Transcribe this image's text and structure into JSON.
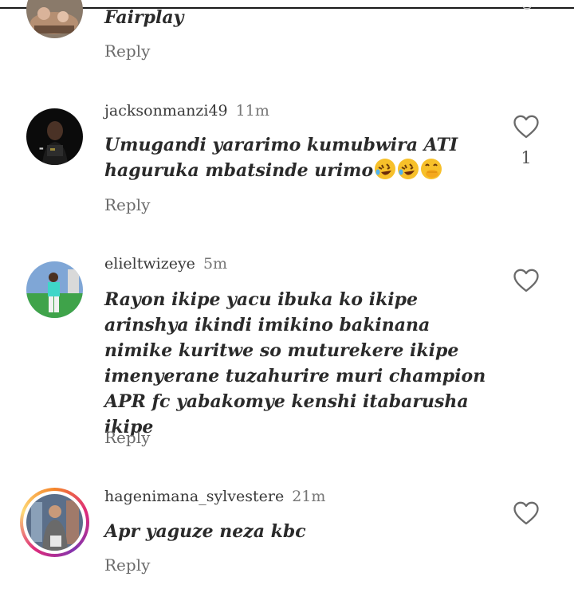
{
  "comments": [
    {
      "username": "",
      "time": "",
      "text": "Fairplay",
      "reply_label": "Reply",
      "likes": ""
    },
    {
      "username": "jacksonmanzi49",
      "time": "11m",
      "text_line1": "Umugandi yararimo kumubwira ATI",
      "text_line2": "haguruka mbatsinde urimo",
      "emojis": [
        "rolling-on-floor-laughing",
        "rolling-on-floor-laughing",
        "face-with-hand-over-mouth"
      ],
      "reply_label": "Reply",
      "likes": "1"
    },
    {
      "username": "elieltwizeye",
      "time": "5m",
      "text": "Rayon ikipe yacu ibuka ko ikipe arinshya ikindi imikino bakinana nimike kuritwe so muturekere ikipe imenyerane tuzahurire muri champion APR fc yabakomye kenshi itabarusha ikipe",
      "reply_label": "Reply",
      "likes": ""
    },
    {
      "username": "hagenimana_sylvestere",
      "time": "21m",
      "text": "Apr yaguze neza kbc",
      "reply_label": "Reply",
      "likes": ""
    }
  ],
  "icons": {
    "like": "heart-outline-icon"
  },
  "colors": {
    "text": "#2a2a2a",
    "muted": "#777777",
    "story_ring_start": "#f58529",
    "story_ring_end": "#8134af"
  }
}
